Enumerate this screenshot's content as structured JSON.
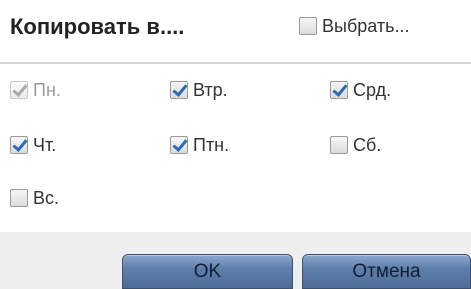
{
  "dialog": {
    "title": "Копировать в....",
    "select_all": {
      "label": "Выбрать...",
      "checked": false
    },
    "days": [
      {
        "label": "Пн.",
        "checked": true,
        "disabled": true
      },
      {
        "label": "Втр.",
        "checked": true,
        "disabled": false
      },
      {
        "label": "Срд.",
        "checked": true,
        "disabled": false
      },
      {
        "label": "Чт.",
        "checked": true,
        "disabled": false
      },
      {
        "label": "Птн.",
        "checked": true,
        "disabled": false
      },
      {
        "label": "Сб.",
        "checked": false,
        "disabled": false
      },
      {
        "label": "Вс.",
        "checked": false,
        "disabled": false
      }
    ],
    "buttons": {
      "ok_label": "OK",
      "cancel_label": "Отмена"
    }
  }
}
